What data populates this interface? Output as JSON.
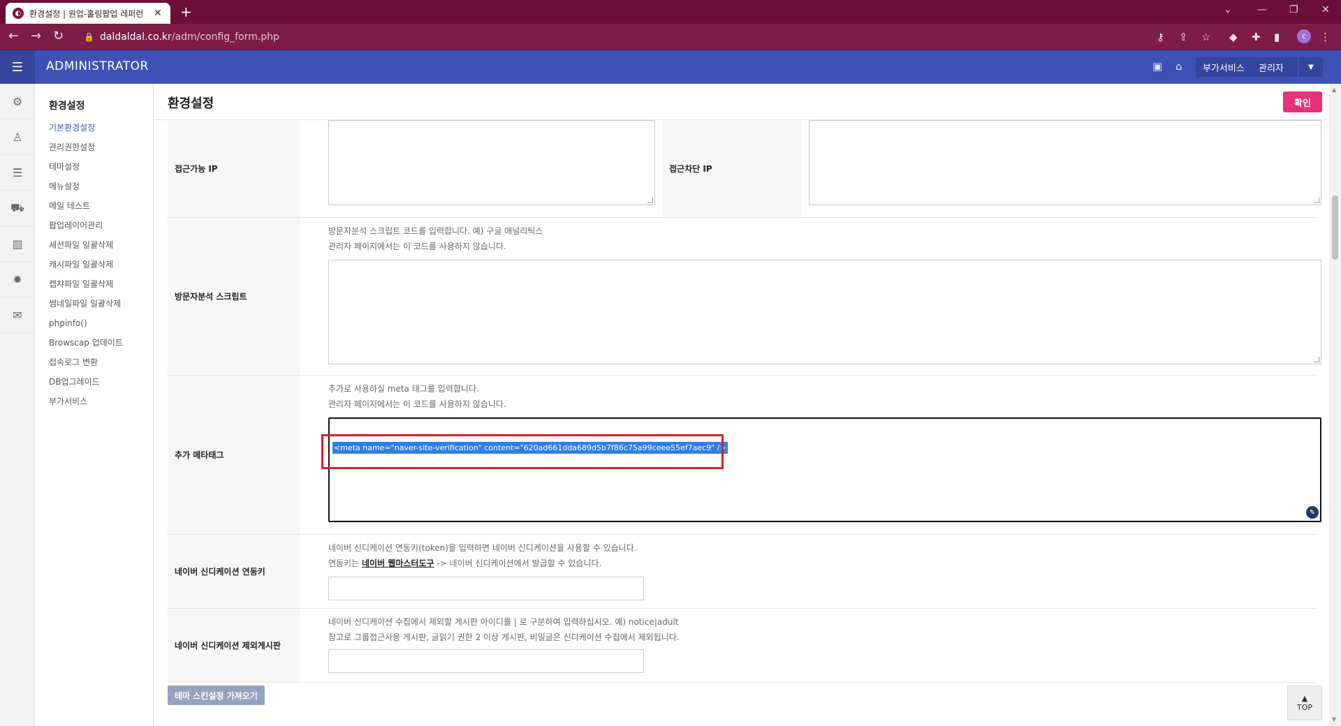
{
  "browser": {
    "tab_title": "환경설정 | 원업-홀링팝업 레퍼런",
    "url_host": "daldaldal.co.kr",
    "url_path": "/adm/config_form.php",
    "profile_initial": "c"
  },
  "header": {
    "brand": "ADMINISTRATOR",
    "services_label": "부가서비스",
    "admin_label": "관리자"
  },
  "rail_icons": [
    "gear-icon",
    "user-icon",
    "list-icon",
    "cart-icon",
    "chart-icon",
    "badge-icon",
    "mail-icon"
  ],
  "submenu": {
    "title": "환경설정",
    "items": [
      {
        "label": "기본환경설정",
        "active": true
      },
      {
        "label": "관리권한설정"
      },
      {
        "label": "테마설정"
      },
      {
        "label": "메뉴설정"
      },
      {
        "label": "메일 테스트"
      },
      {
        "label": "팝업레이어관리"
      },
      {
        "label": "세션파일 일괄삭제"
      },
      {
        "label": "캐시파일 일괄삭제"
      },
      {
        "label": "캡챠파일 일괄삭제"
      },
      {
        "label": "썸네일파일 일괄삭제"
      },
      {
        "label": "phpinfo()"
      },
      {
        "label": "Browscap 업데이트"
      },
      {
        "label": "접속로그 변환"
      },
      {
        "label": "DB업그레이드"
      },
      {
        "label": "부가서비스"
      }
    ]
  },
  "page": {
    "title": "환경설정",
    "confirm_label": "확인"
  },
  "form": {
    "allow_ip_label": "접근가능 IP",
    "block_ip_label": "접근차단 IP",
    "analytics": {
      "label": "방문자분석 스크립트",
      "help1": "방문자분석 스크립트 코드를 입력합니다. 예) 구글 애널리틱스",
      "help2": "관리자 페이지에서는 이 코드를 사용하지 않습니다."
    },
    "meta": {
      "label": "추가 메타태그",
      "help1": "추가로 사용하실 meta 태그를 입력합니다.",
      "help2": "관리자 페이지에서는 이 코드를 사용하지 않습니다.",
      "value": "<meta name=\"naver-site-verification\" content=\"620ad661dda689d5b7f86c75a99ceee55ef7aec9\" />"
    },
    "naver_key": {
      "label": "네이버 신디케이션 연동키",
      "help1": "네이버 신디케이션 연동키(token)을 입력하면 네이버 신디케이션을 사용할 수 있습니다.",
      "help2_pre": "연동키는 ",
      "help2_link": "네이버 웹마스터도구",
      "help2_post": " -> 네이버 신디케이션에서 발급할 수 있습니다."
    },
    "naver_exclude": {
      "label": "네이버 신디케이션 제외게시판",
      "help1": "네이버 신디케이션 수집에서 제외할 게시판 아이디를 | 로 구분하여 입력하십시오. 예) notice|adult",
      "help2": "참고로 그룹접근사용 게시판, 글읽기 권한 2 이상 게시판, 비밀글은 신디케이션 수집에서 제외됩니다."
    },
    "theme_button": "테마 스킨설정 가져오기"
  },
  "top_button": "TOP"
}
